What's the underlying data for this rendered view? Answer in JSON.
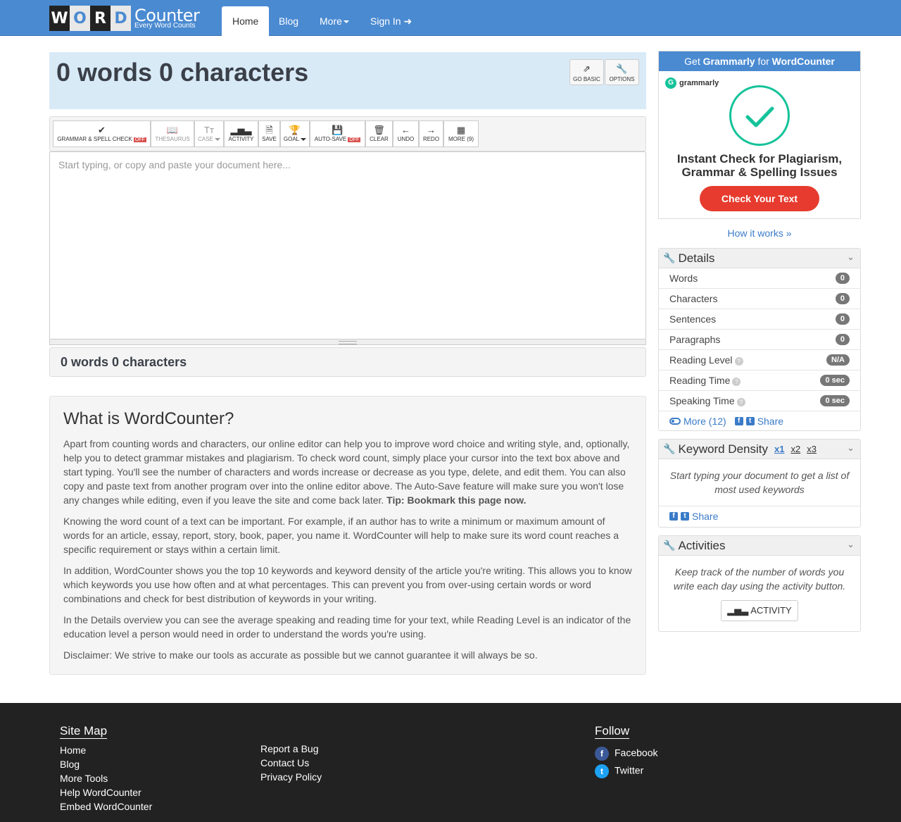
{
  "nav": {
    "logo_letters": [
      "W",
      "O",
      "R",
      "D"
    ],
    "logo_word": "Counter",
    "logo_tagline": "Every Word Counts",
    "items": [
      "Home",
      "Blog",
      "More",
      "Sign In"
    ]
  },
  "header": {
    "title": "0 words 0 characters",
    "go_basic": "GO BASIC",
    "options": "OPTIONS"
  },
  "toolbar": {
    "grammar": "GRAMMAR & SPELL CHECK",
    "off": "OFF",
    "thesaurus": "THESAURUS",
    "case": "CASE",
    "activity": "ACTIVITY",
    "save": "SAVE",
    "goal": "GOAL",
    "autosave": "AUTO-SAVE",
    "clear": "CLEAR",
    "undo": "UNDO",
    "redo": "REDO",
    "more": "MORE (9)"
  },
  "editor": {
    "placeholder": "Start typing, or copy and paste your document here...",
    "footer_count": "0 words 0 characters"
  },
  "about": {
    "title": "What is WordCounter?",
    "p1": "Apart from counting words and characters, our online editor can help you to improve word choice and writing style, and, optionally, help you to detect grammar mistakes and plagiarism. To check word count, simply place your cursor into the text box above and start typing. You'll see the number of characters and words increase or decrease as you type, delete, and edit them. You can also copy and paste text from another program over into the online editor above. The Auto-Save feature will make sure you won't lose any changes while editing, even if you leave the site and come back later.",
    "tip": "Tip: Bookmark this page now.",
    "p2": "Knowing the word count of a text can be important. For example, if an author has to write a minimum or maximum amount of words for an article, essay, report, story, book, paper, you name it. WordCounter will help to make sure its word count reaches a specific requirement or stays within a certain limit.",
    "p3": "In addition, WordCounter shows you the top 10 keywords and keyword density of the article you're writing. This allows you to know which keywords you use how often and at what percentages. This can prevent you from over-using certain words or word combinations and check for best distribution of keywords in your writing.",
    "p4": "In the Details overview you can see the average speaking and reading time for your text, while Reading Level is an indicator of the education level a person would need in order to understand the words you're using.",
    "p5": "Disclaimer: We strive to make our tools as accurate as possible but we cannot guarantee it will always be so."
  },
  "grammarly": {
    "head_prefix": "Get",
    "head_brand": "Grammarly",
    "head_for": "for",
    "head_site": "WordCounter",
    "logo_text": "grammarly",
    "headline": "Instant Check for Plagiarism, Grammar & Spelling Issues",
    "button": "Check Your Text",
    "how_link": "How it works »"
  },
  "details": {
    "title": "Details",
    "rows": [
      {
        "label": "Words",
        "value": "0"
      },
      {
        "label": "Characters",
        "value": "0"
      },
      {
        "label": "Sentences",
        "value": "0"
      },
      {
        "label": "Paragraphs",
        "value": "0"
      },
      {
        "label": "Reading Level",
        "value": "N/A"
      },
      {
        "label": "Reading Time",
        "value": "0 sec"
      },
      {
        "label": "Speaking Time",
        "value": "0 sec"
      }
    ],
    "more": "More (12)",
    "share": "Share"
  },
  "keyword": {
    "title": "Keyword Density",
    "x1": "x1",
    "x2": "x2",
    "x3": "x3",
    "body": "Start typing your document to get a list of most used keywords",
    "share": "Share"
  },
  "activities": {
    "title": "Activities",
    "body": "Keep track of the number of words you write each day using the activity button.",
    "button": "ACTIVITY"
  },
  "footer": {
    "sitemap_title": "Site Map",
    "col1": [
      "Home",
      "Blog",
      "More Tools",
      "Help WordCounter",
      "Embed WordCounter"
    ],
    "col2": [
      "Report a Bug",
      "Contact Us",
      "Privacy Policy"
    ],
    "follow_title": "Follow",
    "social": [
      "Facebook",
      "Twitter"
    ]
  },
  "colors": {
    "nav_blue": "#4a8ad1",
    "header_bg": "#d9eaf7",
    "grammarly_green": "#15c39a",
    "grammarly_red": "#e63b2e",
    "footer_bg": "#222222"
  }
}
